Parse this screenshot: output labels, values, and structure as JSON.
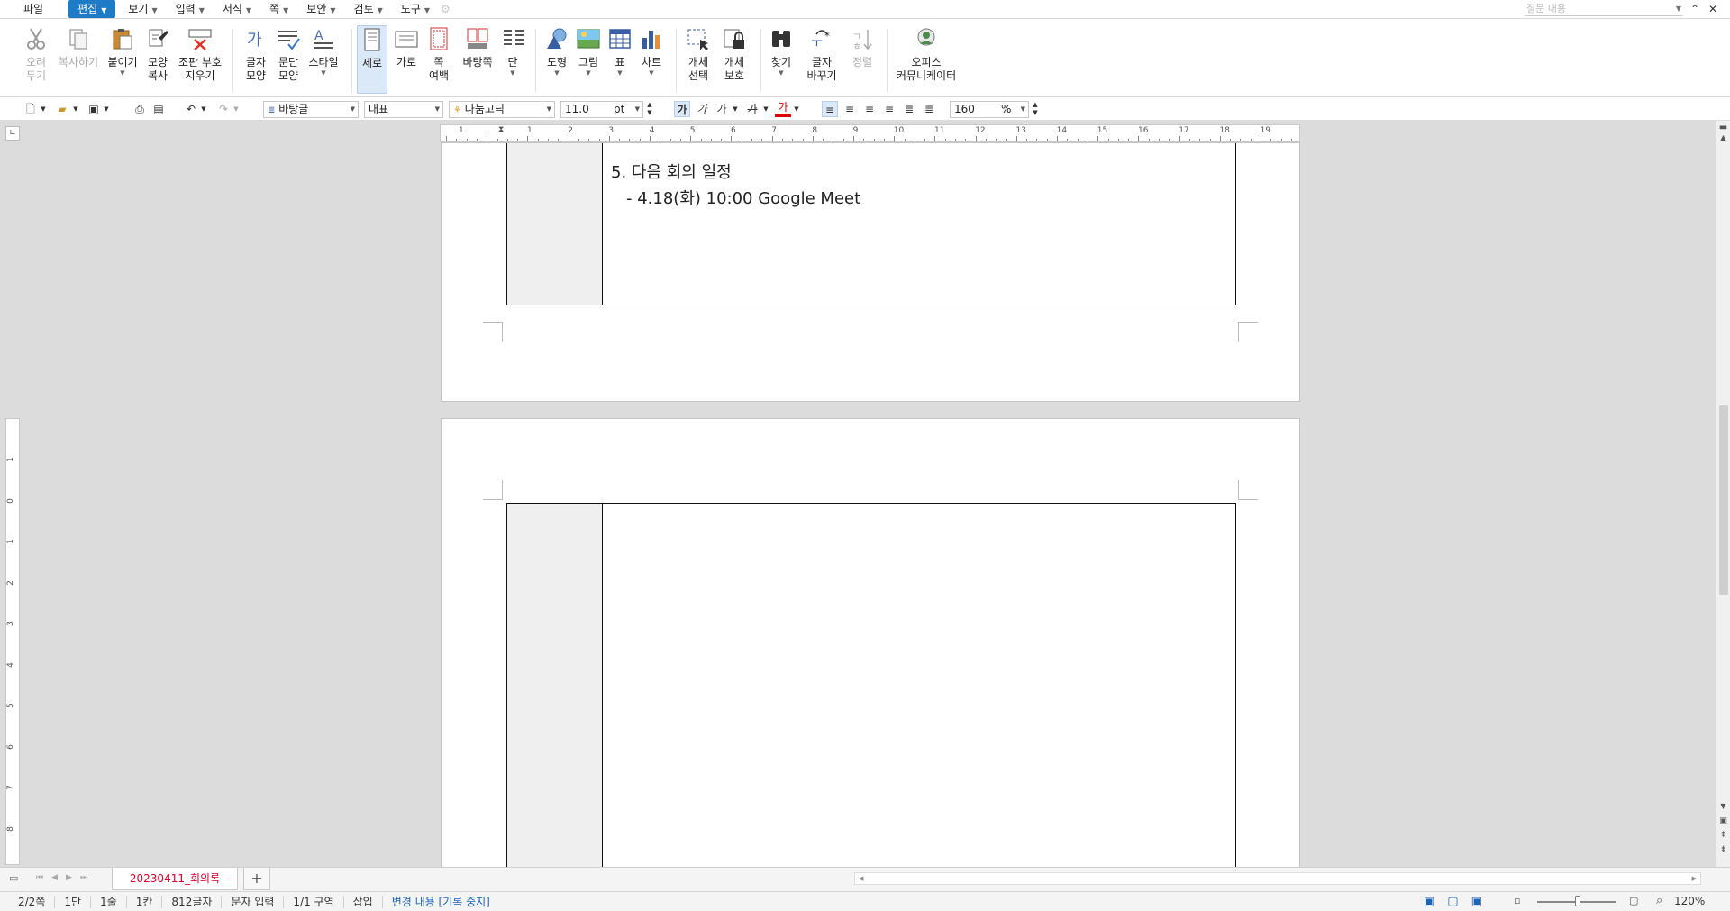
{
  "menubar": {
    "file": "파일",
    "items": [
      {
        "label": "편집",
        "active": true
      },
      {
        "label": "보기",
        "active": false
      },
      {
        "label": "입력",
        "active": false
      },
      {
        "label": "서식",
        "active": false
      },
      {
        "label": "쪽",
        "active": false
      },
      {
        "label": "보안",
        "active": false
      },
      {
        "label": "검토",
        "active": false
      },
      {
        "label": "도구",
        "active": false
      }
    ],
    "search_placeholder": "질문 내용"
  },
  "ribbon": {
    "cut": "오려\n두기",
    "copy": "복사하기",
    "paste": "붙이기",
    "format_copy": "모양\n복사",
    "erase_marks": "조판 부호\n지우기",
    "char_shape": "글자\n모양",
    "para_shape": "문단\n모양",
    "style": "스타일",
    "portrait": "세로",
    "landscape": "가로",
    "page_margin": "쪽\n여백",
    "master_page": "바탕쪽",
    "column": "단",
    "shape": "도형",
    "picture": "그림",
    "table": "표",
    "chart": "차트",
    "object_select": "개체\n선택",
    "object_protect": "개체\n보호",
    "find": "찾기",
    "replace": "글자\n바꾸기",
    "sort": "정렬",
    "office_comm": "오피스\n커뮤니케이터"
  },
  "toolbar": {
    "style_name": "바탕글",
    "lang": "대표",
    "font": "나눔고딕",
    "font_size": "11.0",
    "unit": "pt",
    "bold_glyph": "가",
    "italic_glyph": "가",
    "underline_glyph": "가",
    "strike_glyph": "가",
    "color_glyph": "가",
    "line_spacing": "160",
    "percent": "%"
  },
  "ruler": {
    "h_numbers": [
      "1",
      "1",
      "2",
      "3",
      "4",
      "5",
      "6",
      "7",
      "8",
      "9",
      "10",
      "11",
      "12",
      "13",
      "14",
      "15",
      "16",
      "17",
      "18",
      "19"
    ],
    "v_numbers": [
      "1",
      "0",
      "1",
      "2",
      "3",
      "4",
      "5",
      "6",
      "7",
      "8"
    ]
  },
  "document": {
    "line1": "5. 다음 회의 일정",
    "line2": "- 4.18(화) 10:00 Google Meet"
  },
  "tabs": {
    "doc_name": "20230411_회의록",
    "add": "+"
  },
  "status": {
    "page": "2/2쪽",
    "column": "1단",
    "line": "1줄",
    "col": "1칸",
    "chars": "812글자",
    "mode": "문자 입력",
    "section": "1/1 구역",
    "insert": "삽입",
    "track": "변경 내용 [기록 중지]",
    "zoom": "120%"
  },
  "colors": {
    "accent": "#1e7bc8",
    "doc_tab_text": "#d9002a",
    "track_text": "#1b64b8"
  }
}
